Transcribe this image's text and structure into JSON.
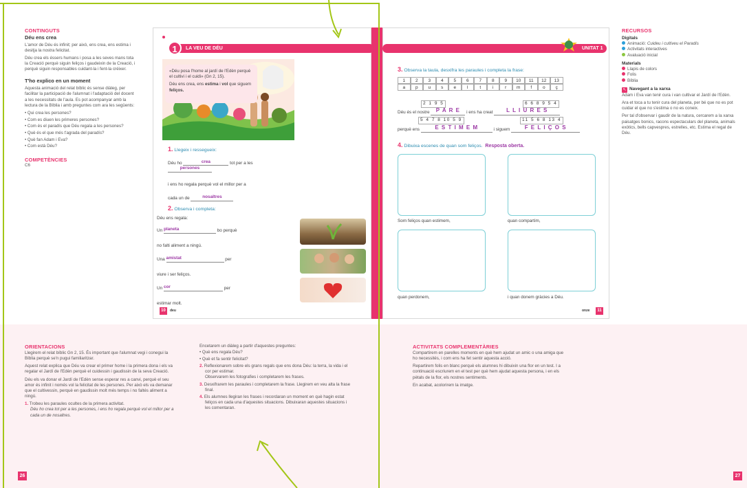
{
  "left_sidebar": {
    "continguts_heading": "CONTINGUTS",
    "sub1": "Déu ens crea",
    "p1": "L'amor de Déu és infinit; per això, ens crea, ens estima i desitja la nostra felicitat.",
    "p2": "Déu crea els éssers humans i posa a les seves mans tota la Creació perquè siguin feliços i gaudeixin de la Creació, i perquè siguin responsables cuidant-la i fent-la créixer.",
    "sub2": "T'ho explico en un moment",
    "p3": "Aquesta animació del relat bíblic és sense diàleg, per facilitar la participació de l'alumnat i l'adaptació del docent a les necessitats de l'aula. Es pot acompanyar amb la lectura de la Bíblia i amb preguntes com ara les següents:",
    "questions": [
      "Qui crea les persones?",
      "Com es diuen les primeres persones?",
      "Com és el paradís que Déu regala a les persones?",
      "Què és el que més t'agrada del paradís?",
      "Què fan Adam i Eva?",
      "Com està Déu?"
    ],
    "competencies_heading": "COMPETÈNCIES",
    "competencies_value": "C6"
  },
  "right_sidebar": {
    "heading": "RECURSOS",
    "digitals_label": "Digitals",
    "digitals": [
      {
        "prefix": "Animació: ",
        "text": "Cuideu i cultiveu el Paradís",
        "color": "#2b9fd9"
      },
      {
        "prefix": "",
        "text": "Activitats interactives",
        "color": "#2b9fd9"
      },
      {
        "prefix": "",
        "text": "Avaluació inicial",
        "color": "#8cc63f"
      }
    ],
    "materials_label": "Materials",
    "materials": [
      {
        "text": "Llapis de colors",
        "color": "#e8336d"
      },
      {
        "text": "Folis",
        "color": "#e8336d"
      },
      {
        "text": "Bíblia",
        "color": "#e8336d"
      }
    ],
    "xarxa_label": "Navegant a la xarxa",
    "xarxa_p1": "Adam i Eva van tenir cura i van cultivar el Jardí de l'Edèn.",
    "xarxa_p2": "Ara et toca a tu tenir cura del planeta, per bé que no es pot cuidar el que no s'estima o no es coneix.",
    "xarxa_p3": "Per tal d'observar i gaudir de la natura, cercarem a la xarxa paisatges bonics, racons espectaculars del planeta, animals exòtics, bells capvespres, estrelles, etc. Estima el regal de Déu."
  },
  "book_left": {
    "lesson_number": "1",
    "lesson_title": "LA VEU DE DÉU",
    "quote": "«Déu posa l'home al jardí de l'Edèn perquè el cultivi i el cuidi» (Gn 2, 15).",
    "lead_pre": "Déu ens crea, ens ",
    "lead_b1": "estima",
    "lead_mid": " i ",
    "lead_b2": "vol",
    "lead_post": " que siguem",
    "lead_b3": "feliços.",
    "a1_num": "1.",
    "a1_text": "Llegeix i ressegueix:",
    "a1_s1": "Déu ho",
    "a1_ans1": "crea",
    "a1_s2": "tot per a les",
    "a1_ans2": "persones",
    "a1_s3": "i ens ho regala perquè vol el millor per a",
    "a1_s4": "cada un de",
    "a1_ans3": "nosaltres",
    "a2_num": "2.",
    "a2_text": "Observa i completa:",
    "a2_intro": "Déu ens regala:",
    "a2_un1": "Un",
    "a2_ans1": "planeta",
    "a2_r1": "bo perquè",
    "a2_l2": "no falti aliment a ningú.",
    "a2_una": "Una",
    "a2_ans2": "amistat",
    "a2_r2": "per",
    "a2_l4": "viure i ser feliços.",
    "a2_un2": "Un",
    "a2_ans3": "cor",
    "a2_r3": "per",
    "a2_l6": "estimar molt.",
    "page_num": "10",
    "page_word": "deu"
  },
  "book_right": {
    "unit_label": "UNITAT 1",
    "a3_num": "3.",
    "a3_text": "Observa la taula, desxifra les paraules i completa la frase:",
    "cipher_nums": [
      "1",
      "2",
      "3",
      "4",
      "5",
      "6",
      "7",
      "8",
      "9",
      "10",
      "11",
      "12",
      "13"
    ],
    "cipher_letters": [
      "a",
      "p",
      "u",
      "s",
      "e",
      "l",
      "t",
      "i",
      "r",
      "m",
      "f",
      "o",
      "ç"
    ],
    "code1": "2 1 9 5",
    "code2": "6 6 8 9 5 4",
    "code3": "5 4 7 8 10 5 9",
    "code4": "11 5 6 8 13 4",
    "s1": "Déu és el nostre",
    "w1": "P A R E",
    "s2": "i ens ha creat",
    "w2": "L L I U R E S",
    "s3": "perquè ens",
    "w3": "E S T I M E M",
    "s4": "i siguem",
    "w4": "F E L I Ç O S",
    "a4_num": "4.",
    "a4_text": "Dibuixa escenes de quan som feliços.",
    "a4_ans": "Resposta oberta.",
    "cap1": "Som feliços quan estimem,",
    "cap2": "quan compartim,",
    "cap3": "quan perdonem,",
    "cap4": "i quan donem gràcies a Déu.",
    "page_num": "11",
    "page_word": "onze"
  },
  "orientacions": {
    "heading": "ORIENTACIONS",
    "p1": "Llegirem el relat bíblic Gn 2, 15. És important que l'alumnat vegi i conegui la Bíblia perquè se'n pugui familiaritzar.",
    "p2": "Aquest relat explica que Déu va crear el primer home i la primera dona i els va regalar el Jardí de l'Edèn perquè el cuidessin i gaudissin de la seva Creació.",
    "p3": "Déu els va donar el Jardí de l'Edèn sense esperar res a canvi, perquè el seu amor és infinit i només vol la felicitat de les persones. Per això els va demanar que el cultivessin, perquè en gaudissin molt més temps i no faltés aliment a ningú.",
    "i1_num": "1.",
    "i1": "Trobeu les paraules ocultes de la primera activitat.",
    "i1_b": "Déu ho crea tot per a les persones, i ens ho regala perquè vol el millor per a cada un de nosaltres.",
    "c2_p1": "Encetarem un diàleg a partir d'aquestes preguntes:",
    "c2_q1": "Què ens regala Déu?",
    "c2_q2": "Què et fa sentir felicitat?",
    "i2_num": "2.",
    "i2": "Reflexionarem sobre els grans regals que ens dona Déu: la terra, la vida i el cor per estimar.",
    "i2_b": "Observarem les fotografies i completarem les frases.",
    "i3_num": "3.",
    "i3": "Desxifrarem les paraules i completarem la frase. Llegirem en veu alta la frase final.",
    "i4_num": "4.",
    "i4": "Els alumnes llegiran les frases i recordaran un moment en què hagin estat feliços en cada una d'aquestes situacions. Dibuixaran aquestes situacions i les comentaran."
  },
  "complementaries": {
    "heading": "ACTIVITATS COMPLEMENTÀRIES",
    "p1": "Compartirem en parelles moments en què hem ajudat un amic o una amiga que ho necessités, i com ens ha fet sentir aquesta acció.",
    "p2": "Repartirem folis en blanc perquè els alumnes hi dibuixin una flor en un test. I a continuació escriurem en el test per què hem ajudat aquesta persona, i en els pètals de la flor, els nostres sentiments.",
    "p3": "En acabat, acolorirem la imatge."
  },
  "page_numbers": {
    "left": "26",
    "right": "27"
  },
  "colors": {
    "accent": "#e8336d",
    "teal": "#2b8bb0",
    "answer": "#9d3aa5",
    "annotation": "#a3c617"
  }
}
